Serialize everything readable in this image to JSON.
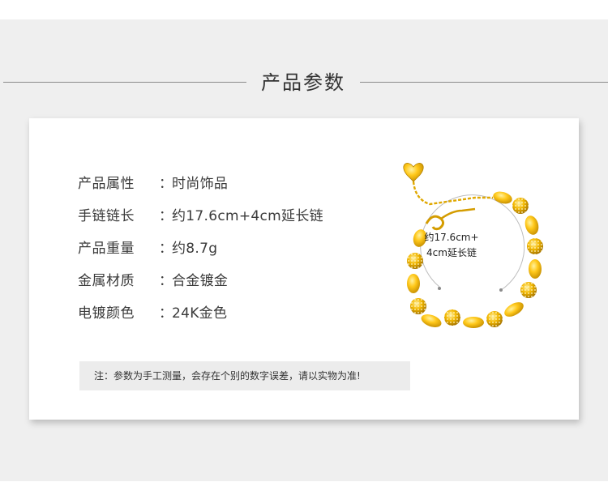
{
  "header": {
    "title": "产品参数"
  },
  "specs": [
    {
      "label": "产品属性",
      "colon": "：",
      "value": "时尚饰品"
    },
    {
      "label": "手链链长",
      "colon": "：",
      "value": "约17.6cm+4cm延长链"
    },
    {
      "label": "产品重量",
      "colon": "：",
      "value": "约8.7g"
    },
    {
      "label": "金属材质",
      "colon": "：",
      "value": "合金镀金"
    },
    {
      "label": "电镀颜色",
      "colon": "：",
      "value": "24K金色"
    }
  ],
  "product_image": {
    "length_line1": "约17.6cm+",
    "length_line2": "4cm延长链"
  },
  "note": {
    "text": "注：参数为手工测量，会存在个别的数字误差，请以实物为准!"
  },
  "colors": {
    "gold": "#e8b000",
    "gold_light": "#ffd84a",
    "gold_dark": "#b98600"
  }
}
